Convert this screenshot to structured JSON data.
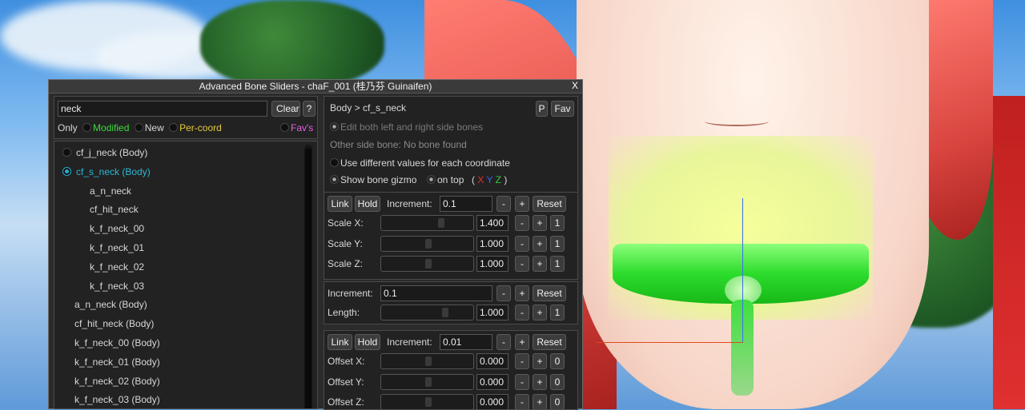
{
  "window": {
    "title": "Advanced Bone Sliders - chaF_001 (桂乃芬 Guinaifen)",
    "close_label": "X"
  },
  "search": {
    "value": "neck",
    "clear_label": "Clear",
    "help_label": "?"
  },
  "filters": {
    "only_label": "Only",
    "modified_label": "Modified",
    "new_label": "New",
    "percoord_label": "Per-coord",
    "favs_label": "Fav's",
    "colors": {
      "modified": "#3cdc3c",
      "percoord": "#e6c83c",
      "favs": "#e060e0"
    }
  },
  "tree": [
    {
      "label": "cf_j_neck (Body)",
      "indent": 0,
      "radio": true,
      "selected": false
    },
    {
      "label": "cf_s_neck (Body)",
      "indent": 0,
      "radio": true,
      "selected": true
    },
    {
      "label": "a_n_neck",
      "indent": 2
    },
    {
      "label": "cf_hit_neck",
      "indent": 2
    },
    {
      "label": "k_f_neck_00",
      "indent": 2
    },
    {
      "label": "k_f_neck_01",
      "indent": 2
    },
    {
      "label": "k_f_neck_02",
      "indent": 2
    },
    {
      "label": "k_f_neck_03",
      "indent": 2
    },
    {
      "label": "a_n_neck (Body)",
      "indent": 1
    },
    {
      "label": "cf_hit_neck (Body)",
      "indent": 1
    },
    {
      "label": "k_f_neck_00 (Body)",
      "indent": 1
    },
    {
      "label": "k_f_neck_01 (Body)",
      "indent": 1
    },
    {
      "label": "k_f_neck_02 (Body)",
      "indent": 1
    },
    {
      "label": "k_f_neck_03 (Body)",
      "indent": 1
    }
  ],
  "selected_color": "#2ab8d8",
  "header": {
    "path": "Body > cf_s_neck",
    "p_label": "P",
    "fav_label": "Fav"
  },
  "options": {
    "edit_both": "Edit both left and right side bones",
    "other_side": "Other side bone: No bone found",
    "diff_values": "Use different values for each coordinate",
    "show_gizmo": "Show bone gizmo",
    "on_top": "on top",
    "axes_open": "(",
    "axes_x": "X",
    "axes_y": "Y",
    "axes_z": "Z",
    "axes_close": ")",
    "axis_colors": {
      "x": "#e03030",
      "y": "#4060f0",
      "z": "#30d040"
    }
  },
  "scale_group": {
    "link_label": "Link",
    "hold_label": "Hold",
    "increment_label": "Increment:",
    "increment_value": "0.1",
    "minus": "-",
    "plus": "+",
    "reset_label": "Reset",
    "rows": [
      {
        "label": "Scale X:",
        "value": "1.400",
        "one": "1",
        "pos": 0.65
      },
      {
        "label": "Scale Y:",
        "value": "1.000",
        "one": "1",
        "pos": 0.5
      },
      {
        "label": "Scale Z:",
        "value": "1.000",
        "one": "1",
        "pos": 0.5
      }
    ]
  },
  "length_group": {
    "increment_label": "Increment:",
    "increment_value": "0.1",
    "minus": "-",
    "plus": "+",
    "reset_label": "Reset",
    "rows": [
      {
        "label": "Length:",
        "value": "1.000",
        "one": "1",
        "pos": 0.7
      }
    ]
  },
  "offset_group": {
    "link_label": "Link",
    "hold_label": "Hold",
    "increment_label": "Increment:",
    "increment_value": "0.01",
    "minus": "-",
    "plus": "+",
    "reset_label": "Reset",
    "rows": [
      {
        "label": "Offset X:",
        "value": "0.000",
        "zero": "0",
        "pos": 0.5
      },
      {
        "label": "Offset Y:",
        "value": "0.000",
        "zero": "0",
        "pos": 0.5
      },
      {
        "label": "Offset Z:",
        "value": "0.000",
        "zero": "0",
        "pos": 0.5
      }
    ]
  }
}
